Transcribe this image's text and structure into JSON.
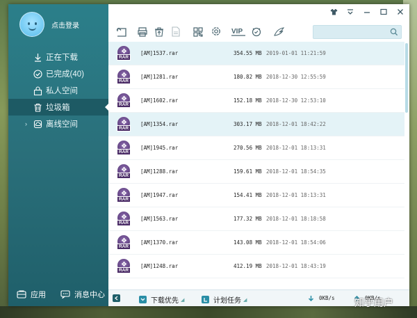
{
  "sidebar": {
    "login_label": "点击登录",
    "items": [
      {
        "label": "正在下载",
        "icon": "download-icon"
      },
      {
        "label": "已完成(40)",
        "icon": "check-circle-icon"
      },
      {
        "label": "私人空间",
        "icon": "lock-icon"
      },
      {
        "label": "垃圾箱",
        "icon": "trash-icon"
      },
      {
        "label": "离线空间",
        "icon": "cloud-icon"
      }
    ],
    "footer": {
      "apps_label": "应用",
      "messages_label": "消息中心"
    }
  },
  "toolbar": {
    "icons": [
      "back-icon",
      "print-icon",
      "restore-icon",
      "file-icon",
      "grid-icon",
      "settings-icon",
      "vip-icon",
      "skin-icon",
      "bird-icon"
    ],
    "vip_text": "VIP",
    "search_placeholder": ""
  },
  "files": [
    {
      "name": "[AM]1537.rar",
      "size": "354.55 MB",
      "date": "2019-01-01 11:21:59",
      "selected": true
    },
    {
      "name": "[AM]1281.rar",
      "size": "180.82 MB",
      "date": "2018-12-30 12:55:59",
      "selected": false
    },
    {
      "name": "[AM]1602.rar",
      "size": "152.18 MB",
      "date": "2018-12-30 12:53:10",
      "selected": false
    },
    {
      "name": "[AM]1354.rar",
      "size": "303.17 MB",
      "date": "2018-12-01 18:42:22",
      "selected": true
    },
    {
      "name": "[AM]1945.rar",
      "size": "270.56 MB",
      "date": "2018-12-01 18:13:31",
      "selected": false
    },
    {
      "name": "[AM]1288.rar",
      "size": "159.61 MB",
      "date": "2018-12-01 18:54:35",
      "selected": false
    },
    {
      "name": "[AM]1947.rar",
      "size": "154.41 MB",
      "date": "2018-12-01 18:13:31",
      "selected": false
    },
    {
      "name": "[AM]1563.rar",
      "size": "177.32 MB",
      "date": "2018-12-01 18:18:58",
      "selected": false
    },
    {
      "name": "[AM]1370.rar",
      "size": "143.08 MB",
      "date": "2018-12-01 18:54:06",
      "selected": false
    },
    {
      "name": "[AM]1248.rar",
      "size": "412.19 MB",
      "date": "2018-12-01 18:43:19",
      "selected": false
    }
  ],
  "file_icon_label": "RAR",
  "status": {
    "priority_label": "下载优先",
    "schedule_label": "计划任务",
    "speed": "0KB/s",
    "up_speed": "0KB/s"
  },
  "watermark": "知乎用户",
  "colors": {
    "sidebar": "#2a7480",
    "selected_row": "#e4f3f7",
    "accent": "#2b7f8a"
  }
}
